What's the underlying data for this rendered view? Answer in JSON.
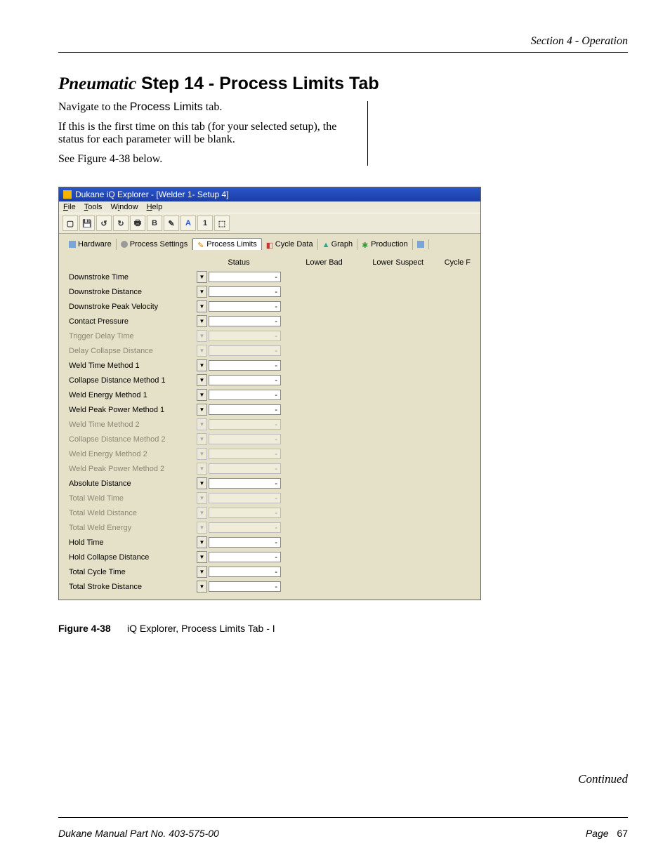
{
  "header": {
    "section": "Section 4 - Operation"
  },
  "title": {
    "prefix": "Pneumatic",
    "rest": " Step 14 - Process Limits Tab"
  },
  "instructions": {
    "p1_a": "Navigate to the ",
    "p1_b": "Process Limits",
    "p1_c": " tab.",
    "p2": "If this is the first time on this tab (for your selected setup), the status for each parameter will be blank.",
    "p3": "See Figure 4-38 below."
  },
  "app": {
    "title": "Dukane iQ Explorer - [Welder 1- Setup 4]",
    "menus": {
      "file": "File",
      "tools": "Tools",
      "window": "Window",
      "help": "Help"
    },
    "toolbar_glyphs": [
      "▢",
      "💾",
      "↺",
      "↻",
      "🖶",
      "B",
      "✎",
      "A",
      "1",
      "⬚"
    ],
    "tabs": {
      "hardware": "Hardware",
      "process_settings": "Process Settings",
      "process_limits": "Process Limits",
      "cycle_data": "Cycle Data",
      "graph": "Graph",
      "production": "Production"
    },
    "columns": {
      "status": "Status",
      "lower_bad": "Lower Bad",
      "lower_suspect": "Lower Suspect",
      "cycle": "Cycle F"
    },
    "params": [
      {
        "label": "Downstroke Time",
        "disabled": false,
        "value": "-"
      },
      {
        "label": "Downstroke Distance",
        "disabled": false,
        "value": "-"
      },
      {
        "label": "Downstroke Peak Velocity",
        "disabled": false,
        "value": "-"
      },
      {
        "label": "Contact Pressure",
        "disabled": false,
        "value": "-"
      },
      {
        "label": "Trigger Delay Time",
        "disabled": true,
        "value": "-"
      },
      {
        "label": "Delay Collapse Distance",
        "disabled": true,
        "value": "-"
      },
      {
        "label": "Weld Time Method 1",
        "disabled": false,
        "value": "-"
      },
      {
        "label": "Collapse Distance Method 1",
        "disabled": false,
        "value": "-"
      },
      {
        "label": "Weld Energy Method 1",
        "disabled": false,
        "value": "-"
      },
      {
        "label": "Weld Peak Power Method 1",
        "disabled": false,
        "value": "-"
      },
      {
        "label": "Weld Time Method 2",
        "disabled": true,
        "value": "-"
      },
      {
        "label": "Collapse Distance Method 2",
        "disabled": true,
        "value": "-"
      },
      {
        "label": "Weld Energy Method 2",
        "disabled": true,
        "value": "-"
      },
      {
        "label": "Weld Peak Power Method 2",
        "disabled": true,
        "value": "-"
      },
      {
        "label": "Absolute Distance",
        "disabled": false,
        "value": "-"
      },
      {
        "label": "Total Weld Time",
        "disabled": true,
        "value": "-"
      },
      {
        "label": "Total Weld Distance",
        "disabled": true,
        "value": "-"
      },
      {
        "label": "Total Weld Energy",
        "disabled": true,
        "value": "-"
      },
      {
        "label": "Hold Time",
        "disabled": false,
        "value": "-"
      },
      {
        "label": "Hold Collapse Distance",
        "disabled": false,
        "value": "-"
      },
      {
        "label": "Total Cycle Time",
        "disabled": false,
        "value": "-"
      },
      {
        "label": "Total Stroke Distance",
        "disabled": false,
        "value": "-"
      }
    ]
  },
  "figure": {
    "label": "Figure 4-38",
    "caption": "iQ Explorer, Process Limits Tab - I"
  },
  "continued": "Continued",
  "footer": {
    "left": "Dukane Manual Part No. 403-575-00",
    "page_word": "Page",
    "page_num": "67"
  }
}
